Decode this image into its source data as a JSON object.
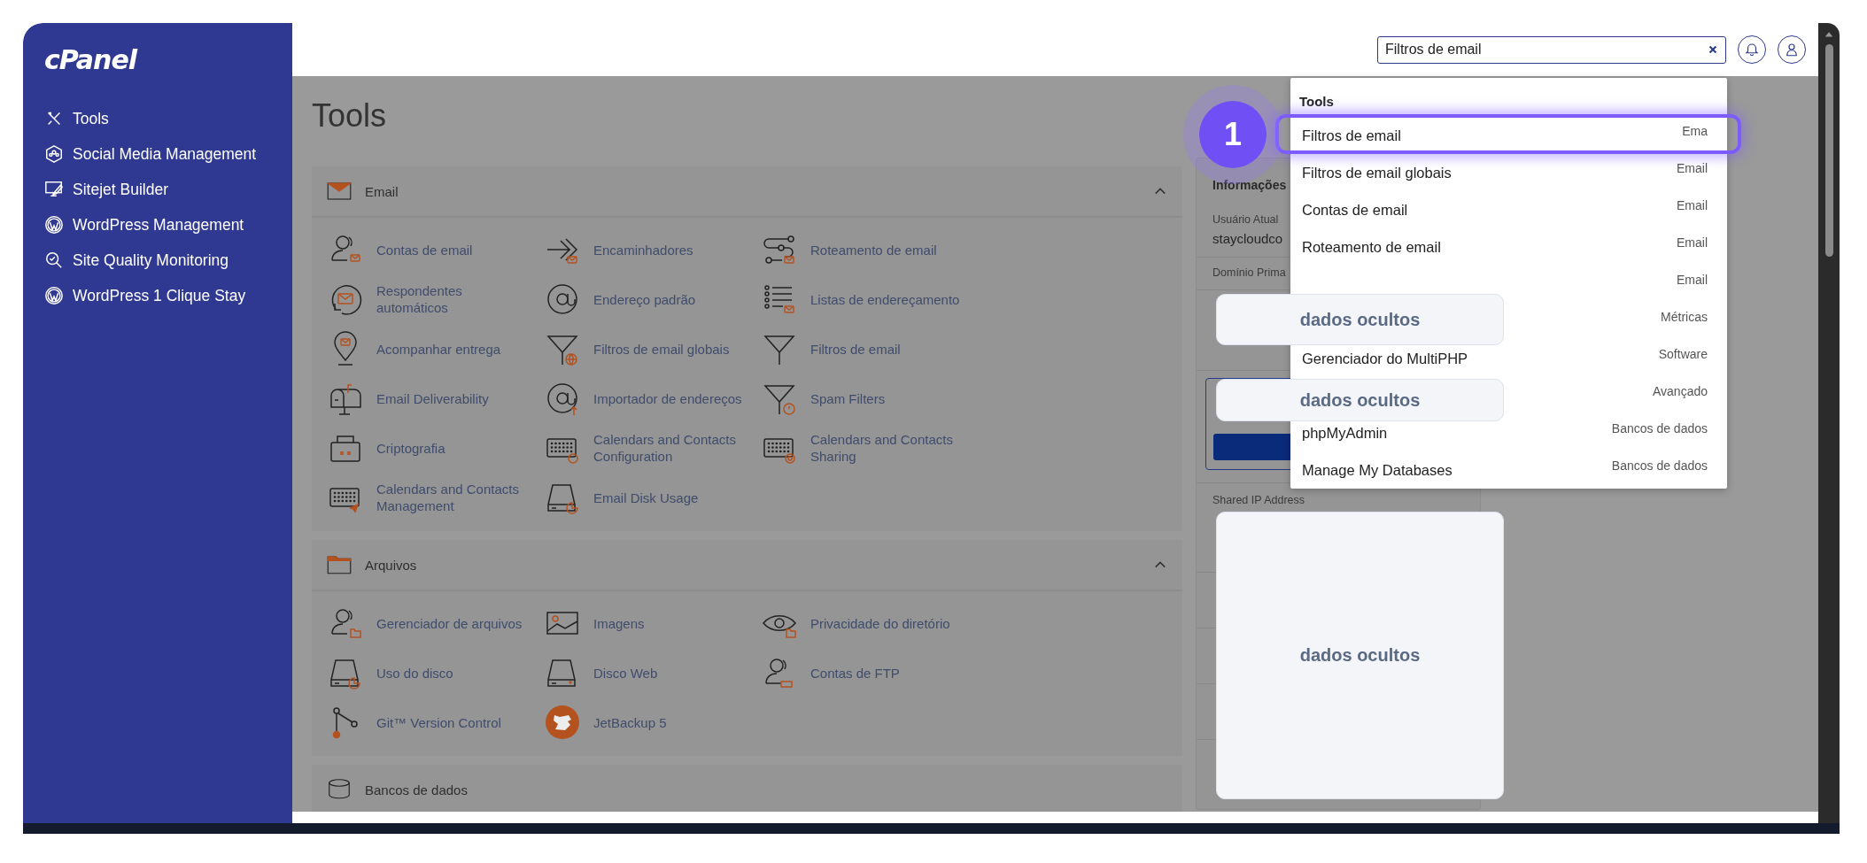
{
  "sidebar": {
    "logo": "cPanel",
    "items": [
      {
        "label": "Tools"
      },
      {
        "label": "Social Media Management"
      },
      {
        "label": "Sitejet Builder"
      },
      {
        "label": "WordPress Management"
      },
      {
        "label": "Site Quality Monitoring"
      },
      {
        "label": "WordPress 1 Clique Stay"
      }
    ]
  },
  "header": {
    "search": {
      "value": "Filtros de email"
    }
  },
  "page": {
    "title": "Tools"
  },
  "sections": [
    {
      "title": "Email",
      "expanded": true,
      "items": [
        "Contas de email",
        "Encaminhadores",
        "Roteamento de email",
        "Respondentes automáticos",
        "Endereço padrão",
        "Listas de endereçamento",
        "Acompanhar entrega",
        "Filtros de email globais",
        "Filtros de email",
        "Email Deliverability",
        "Importador de endereços",
        "Spam Filters",
        "Criptografia",
        "Calendars and Contacts Configuration",
        "Calendars and Contacts Sharing",
        "Calendars and Contacts Management",
        "Email Disk Usage"
      ]
    },
    {
      "title": "Arquivos",
      "expanded": true,
      "items": [
        "Gerenciador de arquivos",
        "Imagens",
        "Privacidade do diretório",
        "Uso do disco",
        "Disco Web",
        "Contas de FTP",
        "Git™ Version Control",
        "JetBackup 5"
      ]
    },
    {
      "title": "Bancos de dados"
    }
  ],
  "info_panel": {
    "title": "Informações",
    "fields": [
      {
        "label": "Usuário Atual",
        "value": "staycloudco"
      },
      {
        "label": "Domínio Prima"
      }
    ],
    "shared_ip_label": "Shared IP Address"
  },
  "search_results": {
    "heading": "Tools",
    "items": [
      {
        "name": "Filtros de email",
        "category": "Ema",
        "selected": true
      },
      {
        "name": "Filtros de email globais",
        "category": "Email",
        "selected": false
      },
      {
        "name": "Contas de email",
        "category": "Email",
        "selected": false
      },
      {
        "name": "Roteamento de email",
        "category": "Email",
        "selected": false
      },
      {
        "category": "Email",
        "selected": false
      },
      {
        "category": "Métricas",
        "selected": false
      },
      {
        "name": "Gerenciador do MultiPHP",
        "category": "Software",
        "selected": false
      },
      {
        "category": "Avançado",
        "selected": false
      },
      {
        "name": "phpMyAdmin",
        "category": "Bancos de dados",
        "selected": false
      },
      {
        "name": "Manage My Databases",
        "category": "Bancos de dados",
        "selected": false
      }
    ]
  },
  "annotation": {
    "step": "1"
  },
  "redactions": [
    "dados ocultos",
    "dados ocultos",
    "dados ocultos"
  ]
}
